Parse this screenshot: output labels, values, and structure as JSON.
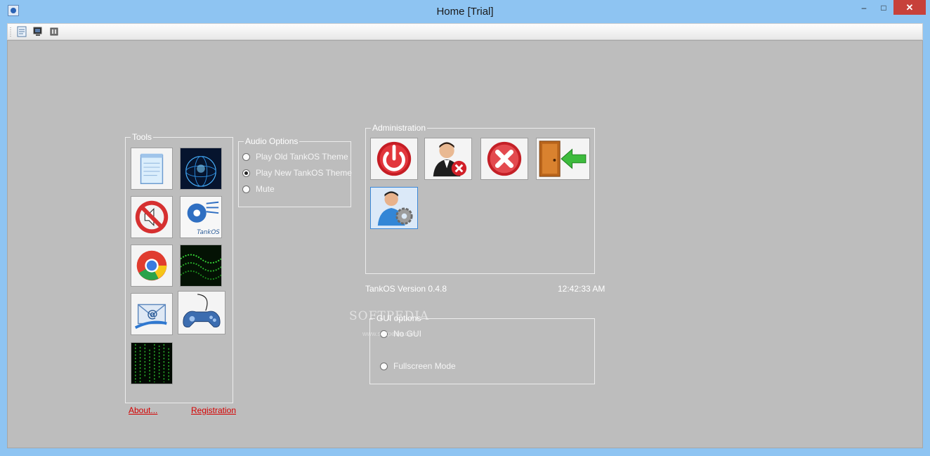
{
  "window": {
    "title": "Home [Trial]"
  },
  "titlebar": {
    "minimize": "–",
    "maximize": "□",
    "close": "✕"
  },
  "tools": {
    "label": "Tools"
  },
  "audio": {
    "label": "Audio Options",
    "options": [
      "Play Old TankOS Theme",
      "Play New TankOS Theme",
      "Mute"
    ],
    "selected": "Play New TankOS Theme"
  },
  "admin": {
    "label": "Administration"
  },
  "status": {
    "version": "TankOS Version 0.4.8",
    "time": "12:42:33 AM"
  },
  "gui": {
    "label": "GUI options",
    "options": [
      "No GUI",
      "Fullscreen Mode"
    ]
  },
  "links": {
    "about": "About...",
    "registration": "Registration"
  },
  "tankos_logo_text": "TankOS",
  "watermark": {
    "text": "SOFTPEDIA",
    "url": "www.softpedia.com"
  },
  "colors": {
    "window_frame": "#8ec4f2",
    "client_bg": "#bdbdbd",
    "link": "#d40000",
    "close_button": "#c7413a"
  }
}
